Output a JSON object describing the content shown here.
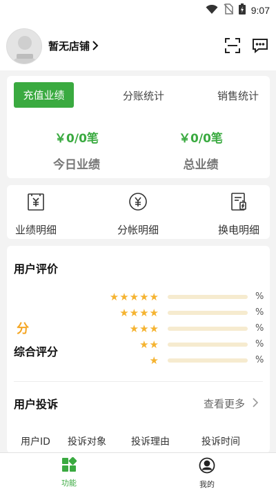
{
  "status": {
    "time": "9:07"
  },
  "header": {
    "store_name": "暂无店铺"
  },
  "performance": {
    "tabs": [
      "充值业绩",
      "分账统计",
      "销售统计"
    ],
    "today_amount": "￥0/0笔",
    "total_amount": "￥0/0笔",
    "today_label": "今日业绩",
    "total_label": "总业绩"
  },
  "quick_links": [
    "业绩明细",
    "分帐明细",
    "换电明细"
  ],
  "reviews": {
    "title": "用户评价",
    "score": "分",
    "score_label": "综合评分",
    "ratings": [
      {
        "stars": "★★★★★",
        "pct": "%",
        "fill": 0
      },
      {
        "stars": "★★★★",
        "pct": "%",
        "fill": 0
      },
      {
        "stars": "★★★",
        "pct": "%",
        "fill": 0
      },
      {
        "stars": "★★",
        "pct": "%",
        "fill": 0
      },
      {
        "stars": "★",
        "pct": "%",
        "fill": 0
      }
    ]
  },
  "complaints": {
    "title": "用户投诉",
    "more": "查看更多",
    "columns": [
      "用户ID",
      "投诉对象",
      "投诉理由",
      "投诉时间"
    ]
  },
  "tabbar": {
    "items": [
      "功能",
      "我的"
    ],
    "active_color": "#3aaa40"
  }
}
